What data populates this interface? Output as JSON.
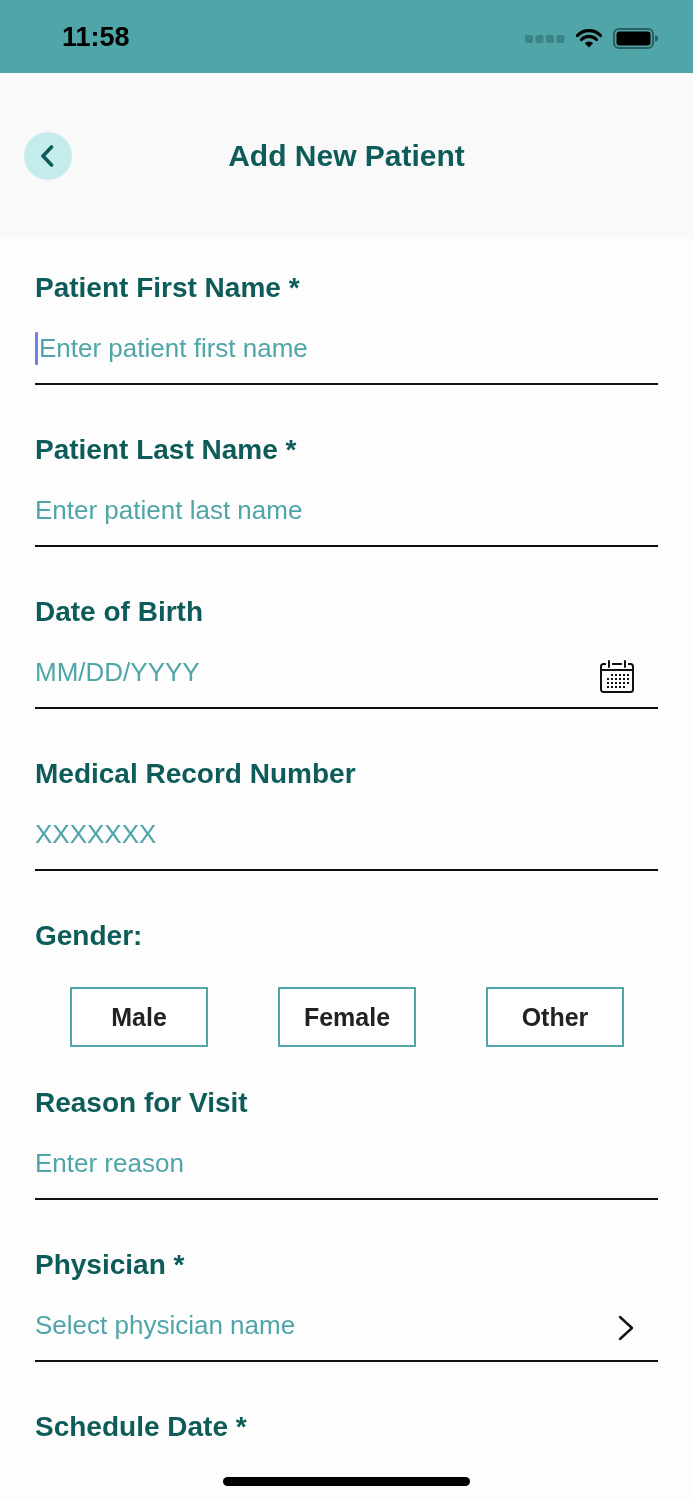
{
  "status_bar": {
    "time": "11:58"
  },
  "header": {
    "title": "Add New Patient"
  },
  "form": {
    "fields": [
      {
        "kind": "text",
        "label": "Patient First Name *",
        "placeholder": "Enter patient first name",
        "focused": true
      },
      {
        "kind": "text",
        "label": "Patient Last Name *",
        "placeholder": "Enter patient last name",
        "focused": false
      },
      {
        "kind": "date",
        "label": "Date of Birth",
        "placeholder": "MM/DD/YYYY",
        "focused": false
      },
      {
        "kind": "text",
        "label": "Medical Record Number",
        "placeholder": "XXXXXXX",
        "focused": false
      },
      {
        "kind": "choice",
        "label": "Gender:",
        "options": [
          {
            "label": "Male",
            "selected": false
          },
          {
            "label": "Female",
            "selected": false
          },
          {
            "label": "Other",
            "selected": false
          }
        ]
      },
      {
        "kind": "text",
        "label": "Reason for Visit",
        "placeholder": "Enter reason",
        "focused": false
      },
      {
        "kind": "select",
        "label": "Physician *",
        "placeholder": "Select physician name",
        "focused": false
      },
      {
        "kind": "label",
        "label": "Schedule Date *"
      }
    ]
  }
}
